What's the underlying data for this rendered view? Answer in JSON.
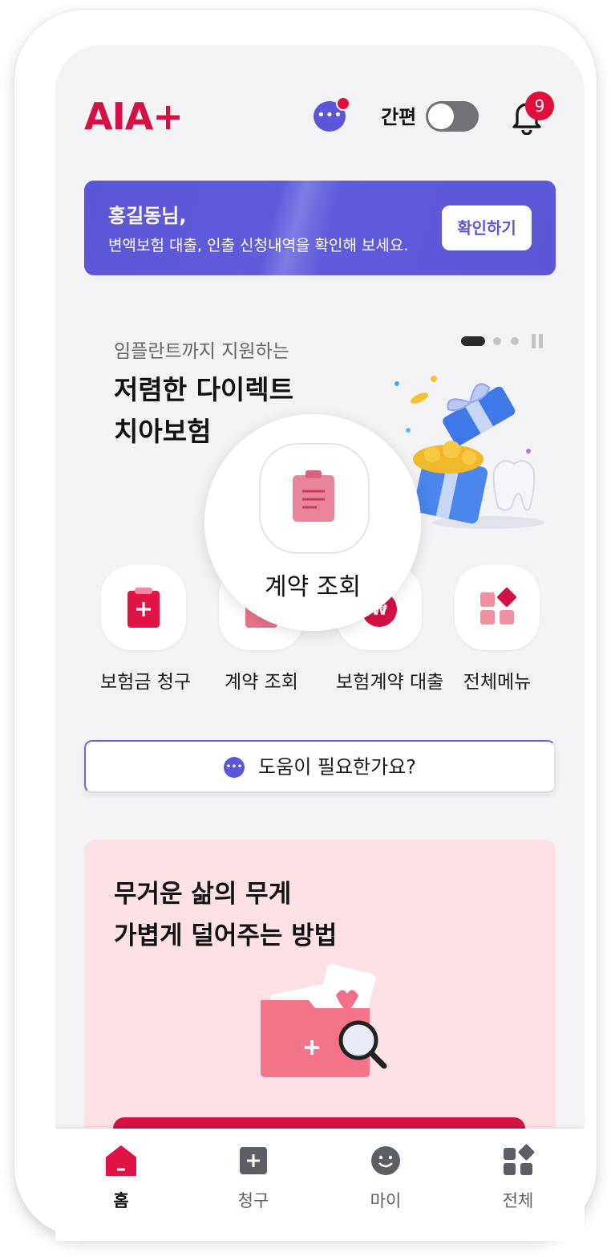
{
  "header": {
    "logo": "AIA+",
    "easy_mode_label": "간편",
    "easy_mode_on": false,
    "notification_count": "9"
  },
  "banner": {
    "greeting": "홍길동님,",
    "message": "변액보험 대출, 인출 신청내역을 확인해 보세요.",
    "button_label": "확인하기"
  },
  "promo": {
    "subtitle": "임플란트까지 지원하는",
    "title_line1": "저렴한 다이렉트",
    "title_line2": "치아보험"
  },
  "quick_menu": [
    {
      "label": "보험금 청구",
      "icon": "clipboard-plus-icon"
    },
    {
      "label": "계약 조회",
      "icon": "clipboard-list-icon"
    },
    {
      "label": "보험계약 대출",
      "icon": "won-icon"
    },
    {
      "label": "전체메뉴",
      "icon": "grid-icon"
    }
  ],
  "zoom_tooltip": {
    "label": "계약 조회"
  },
  "help": {
    "label": "도움이 필요한가요?"
  },
  "card": {
    "title_line1": "무거운 삶의 무게",
    "title_line2": "가볍게 덜어주는 방법"
  },
  "tabbar": [
    {
      "label": "홈",
      "active": true
    },
    {
      "label": "청구",
      "active": false
    },
    {
      "label": "마이",
      "active": false
    },
    {
      "label": "전체",
      "active": false
    }
  ],
  "colors": {
    "brand_red": "#d31145",
    "accent_purple": "#5b57d6",
    "card_pink": "#fde1e5"
  }
}
